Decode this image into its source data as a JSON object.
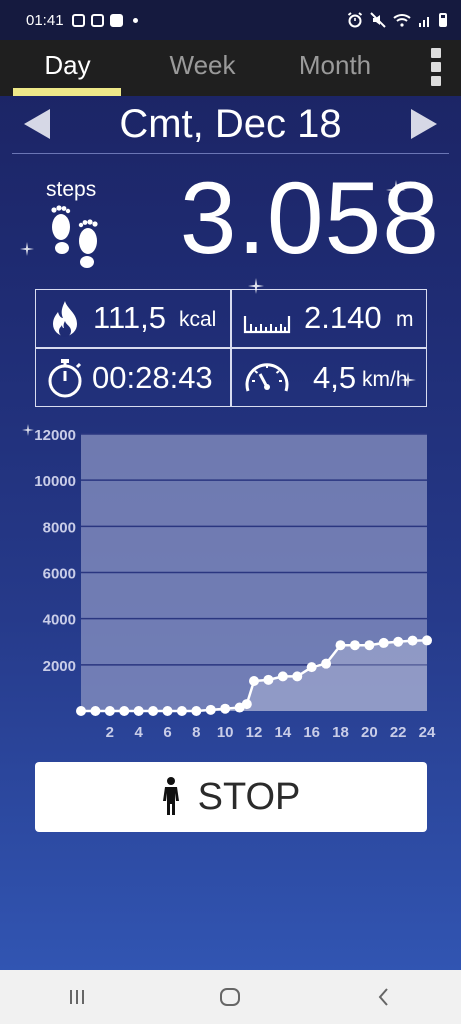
{
  "status_bar": {
    "time": "01:41"
  },
  "tabs": [
    {
      "label": "Day",
      "active": true
    },
    {
      "label": "Week",
      "active": false
    },
    {
      "label": "Month",
      "active": false
    }
  ],
  "date": {
    "label": "Cmt, Dec 18"
  },
  "steps": {
    "label": "steps",
    "value": "3.058"
  },
  "stats": {
    "calories": {
      "value": "111,5",
      "unit": "kcal",
      "icon": "flame-icon"
    },
    "distance": {
      "value": "2.140",
      "unit": "m",
      "icon": "ruler-icon"
    },
    "duration": {
      "value": "00:28:43",
      "icon": "stopwatch-icon"
    },
    "speed": {
      "value": "4,5",
      "unit": "km/h",
      "icon": "speedometer-icon"
    }
  },
  "chart_data": {
    "type": "line",
    "title": "",
    "xlabel": "",
    "ylabel": "",
    "x_ticks": [
      "2",
      "4",
      "6",
      "8",
      "10",
      "12",
      "14",
      "16",
      "18",
      "20",
      "22",
      "24"
    ],
    "y_ticks": [
      "2000",
      "4000",
      "6000",
      "8000",
      "10000",
      "12000"
    ],
    "xlim": [
      0,
      24
    ],
    "ylim": [
      0,
      12000
    ],
    "grid": true,
    "x": [
      0,
      1,
      2,
      3,
      4,
      5,
      6,
      7,
      8,
      9,
      10,
      11,
      11.5,
      12,
      13,
      14,
      15,
      16,
      17,
      18,
      19,
      20,
      21,
      22,
      23,
      24
    ],
    "values": [
      0,
      0,
      0,
      0,
      0,
      0,
      0,
      0,
      0,
      50,
      100,
      150,
      300,
      1300,
      1350,
      1500,
      1500,
      1900,
      2050,
      2850,
      2850,
      2850,
      2950,
      3000,
      3050,
      3058
    ]
  },
  "stop_button": {
    "label": "STOP"
  },
  "colors": {
    "tab_indicator": "#eee889",
    "chart_area": "#8a93c2",
    "background_top": "#1b2260",
    "background_bottom": "#3359b8"
  }
}
